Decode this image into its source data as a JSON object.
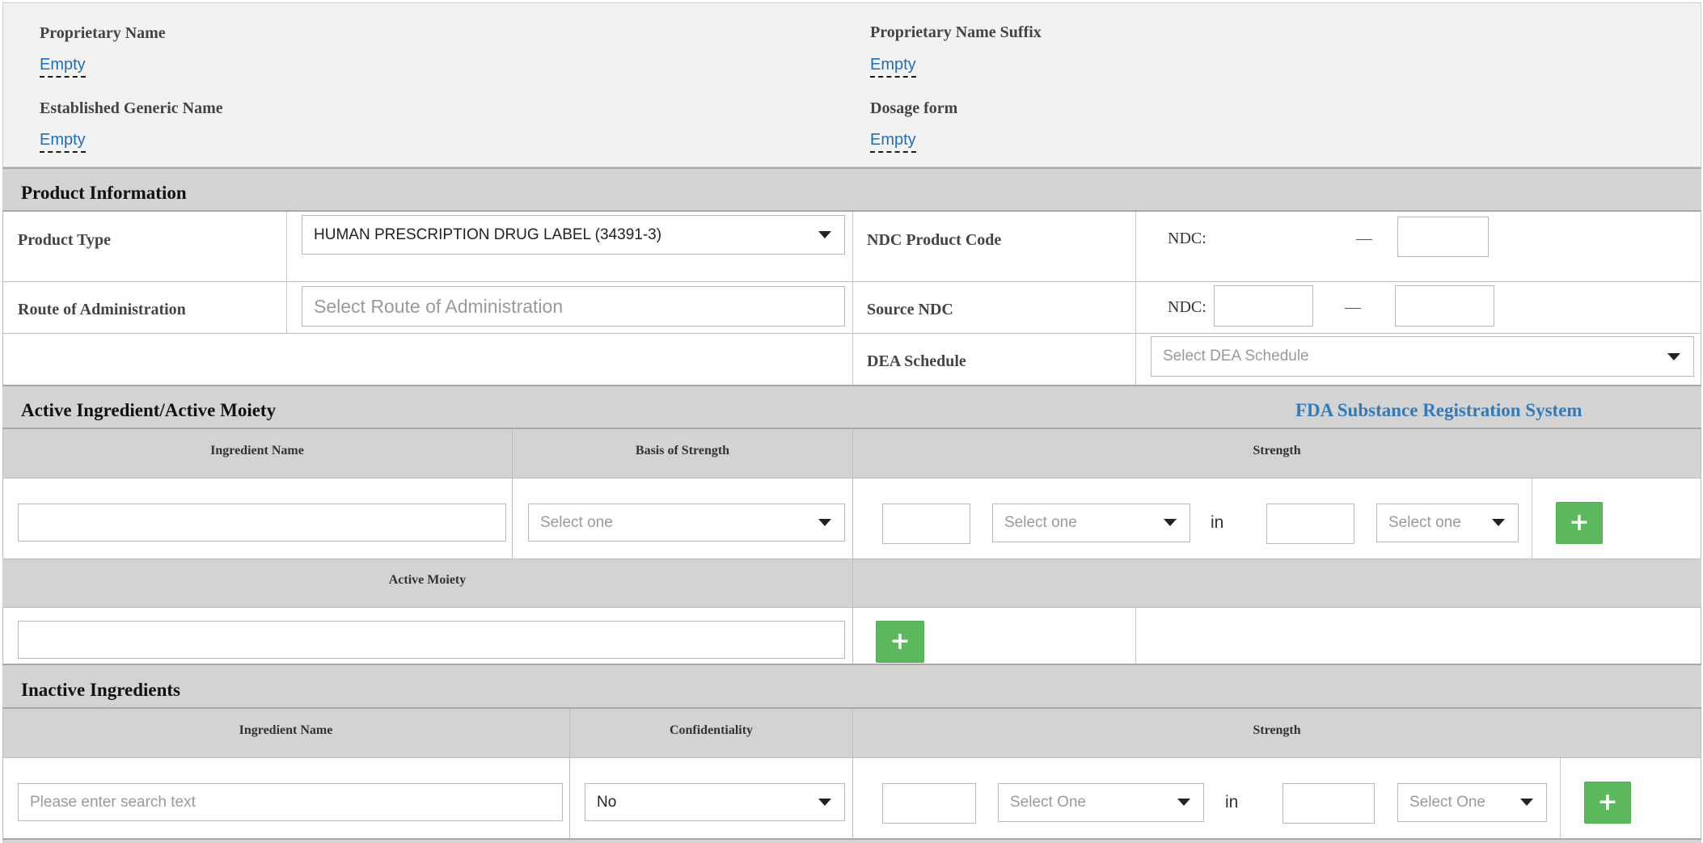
{
  "summary": {
    "proprietary_name_label": "Proprietary Name",
    "proprietary_name_value": "Empty",
    "proprietary_suffix_label": "Proprietary Name Suffix",
    "proprietary_suffix_value": "Empty",
    "generic_name_label": "Established Generic Name",
    "generic_name_value": "Empty",
    "dosage_form_label": "Dosage form",
    "dosage_form_value": "Empty"
  },
  "product_info": {
    "title": "Product Information",
    "product_type_label": "Product Type",
    "product_type_value": "HUMAN PRESCRIPTION DRUG LABEL (34391-3)",
    "ndc_product_code_label": "NDC Product Code",
    "ndc_prefix": "NDC:",
    "route_label": "Route of Administration",
    "route_placeholder": "Select Route of Administration",
    "source_ndc_label": "Source NDC",
    "source_ndc_prefix": "NDC:",
    "dea_label": "DEA Schedule",
    "dea_placeholder": "Select DEA Schedule"
  },
  "active": {
    "title": "Active Ingredient/Active Moiety",
    "fda_link": "FDA Substance Registration System",
    "col_ingredient": "Ingredient Name",
    "col_basis": "Basis of Strength",
    "col_strength": "Strength",
    "basis_placeholder": "Select one",
    "unit1_placeholder": "Select one",
    "in_text": "in",
    "unit2_placeholder": "Select one",
    "add_symbol": "+",
    "moiety_header": "Active Moiety",
    "moiety_add_symbol": "+"
  },
  "inactive": {
    "title": "Inactive Ingredients",
    "col_ingredient": "Ingredient Name",
    "col_confidentiality": "Confidentiality",
    "col_strength": "Strength",
    "search_placeholder": "Please enter search text",
    "confidentiality_value": "No",
    "unit1_placeholder": "Select One",
    "in_text": "in",
    "unit2_placeholder": "Select One",
    "add_symbol": "+"
  },
  "colors": {
    "link": "#1f6fb5",
    "fda_link": "#337ab7",
    "add_button": "#5cb85c",
    "section_header": "#d3d3d3",
    "summary_bg": "#f2f2f2"
  }
}
